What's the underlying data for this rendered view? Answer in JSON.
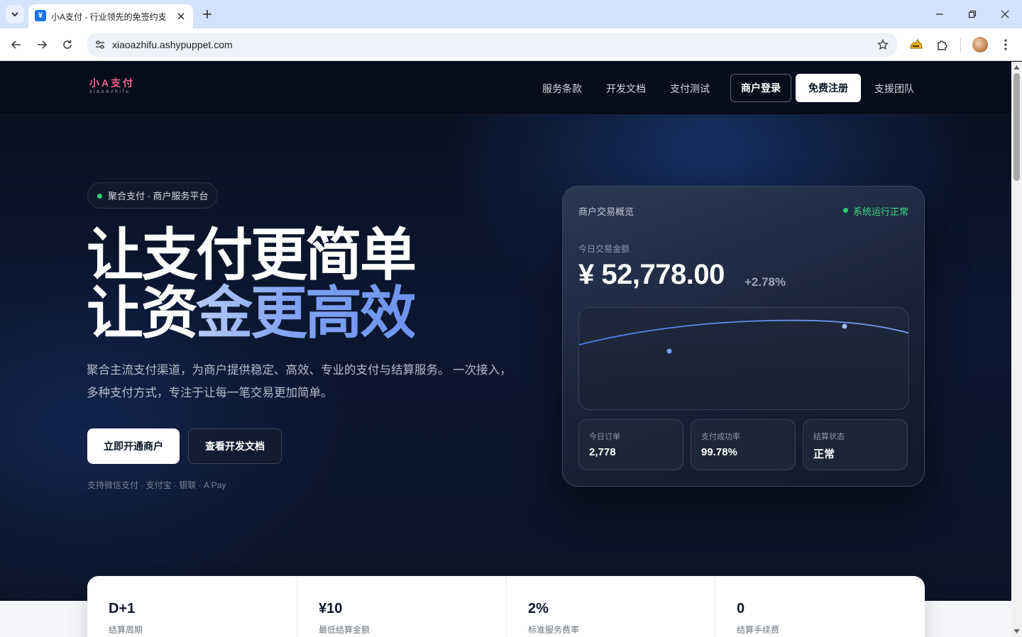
{
  "browser": {
    "tab_title": "小A支付 - 行业领先的免签约支",
    "favicon_glyph": "¥",
    "url": "xiaoazhifu.ashypuppet.com"
  },
  "site": {
    "logo_main": "小A支付",
    "logo_sub": "xiaoAzhifu",
    "nav": {
      "terms": "服务条款",
      "docs": "开发文档",
      "pay_test": "支付测试",
      "login": "商户登录",
      "register": "免费注册",
      "support": "支援团队"
    }
  },
  "hero": {
    "badge": "聚合支付 · 商户服务平台",
    "title_line1": "让支付更简单",
    "title_line2_plain": "让资",
    "title_line2_highlight": "金更高效",
    "description": "聚合主流支付渠道，为商户提供稳定、高效、专业的支付与结算服务。 一次接入，多种支付方式，专注于让每一笔交易更加简单。",
    "cta_primary": "立即开通商户",
    "cta_secondary": "查看开发文档",
    "support_text": "支持微信支付 · 支付宝 · 银联 · A Pay"
  },
  "dashboard": {
    "title": "商户交易概览",
    "status": "系统运行正常",
    "amount_label": "今日交易金额",
    "amount": "¥ 52,778.00",
    "change": "+2.78%",
    "stats": [
      {
        "label": "今日订单",
        "value": "2,778"
      },
      {
        "label": "支付成功率",
        "value": "99.78%"
      },
      {
        "label": "结算状态",
        "value": "正常"
      }
    ]
  },
  "summary": [
    {
      "value": "D+1",
      "label": "结算周期"
    },
    {
      "value": "¥10",
      "label": "最低结算金额"
    },
    {
      "value": "2%",
      "label": "标准服务费率"
    },
    {
      "value": "0",
      "label": "结算手续费"
    }
  ],
  "colors": {
    "accent_blue": "#7ea2f2",
    "status_green": "#3ddc84",
    "logo_pink": "#f06292"
  }
}
